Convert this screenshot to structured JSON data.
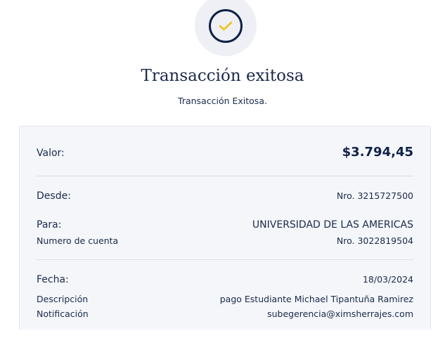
{
  "header": {
    "title": "Transacción exitosa",
    "subtitle": "Transacción Exitosa.",
    "status_icon": "check-icon",
    "colors": {
      "navy": "#0f2147",
      "check": "#f2c21b",
      "circle_bg": "#eef0f5"
    }
  },
  "summary": {
    "valor_label": "Valor:",
    "valor_amount": "$3.794,45",
    "desde_label": "Desde:",
    "desde_value": "Nro. 3215727500",
    "para_label": "Para:",
    "para_value": "UNIVERSIDAD DE LAS AMERICAS",
    "cuenta_label": "Numero de cuenta",
    "cuenta_value": "Nro. 3022819504",
    "fecha_label": "Fecha:",
    "fecha_value": "18/03/2024",
    "descripcion_label": "Descripción",
    "descripcion_value": "pago Estudiante Michael Tipantuña Ramirez",
    "notificacion_label": "Notificación",
    "notificacion_value": "subegerencia@ximsherrajes.com"
  }
}
